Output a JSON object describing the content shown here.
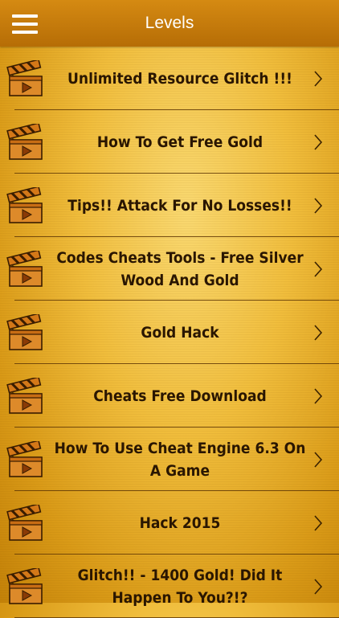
{
  "header": {
    "title": "Levels"
  },
  "icons": {
    "menu": "hamburger-menu-icon",
    "item": "clapperboard-icon",
    "disclosure": "chevron-right-icon"
  },
  "colors": {
    "header": "#c27a0b",
    "background": "#f0bd3c",
    "text": "#2a1601"
  },
  "items": [
    {
      "label": "Unlimited Resource Glitch !!!"
    },
    {
      "label": "How To Get Free Gold"
    },
    {
      "label": "Tips!! Attack For No Losses!!"
    },
    {
      "label": "Codes Cheats Tools - Free Silver Wood And Gold"
    },
    {
      "label": "Gold Hack"
    },
    {
      "label": "Cheats Free Download"
    },
    {
      "label": "How To Use Cheat Engine 6.3 On A Game"
    },
    {
      "label": "Hack 2015"
    },
    {
      "label": "Glitch!! - 1400 Gold! Did It Happen To You?!?"
    }
  ]
}
